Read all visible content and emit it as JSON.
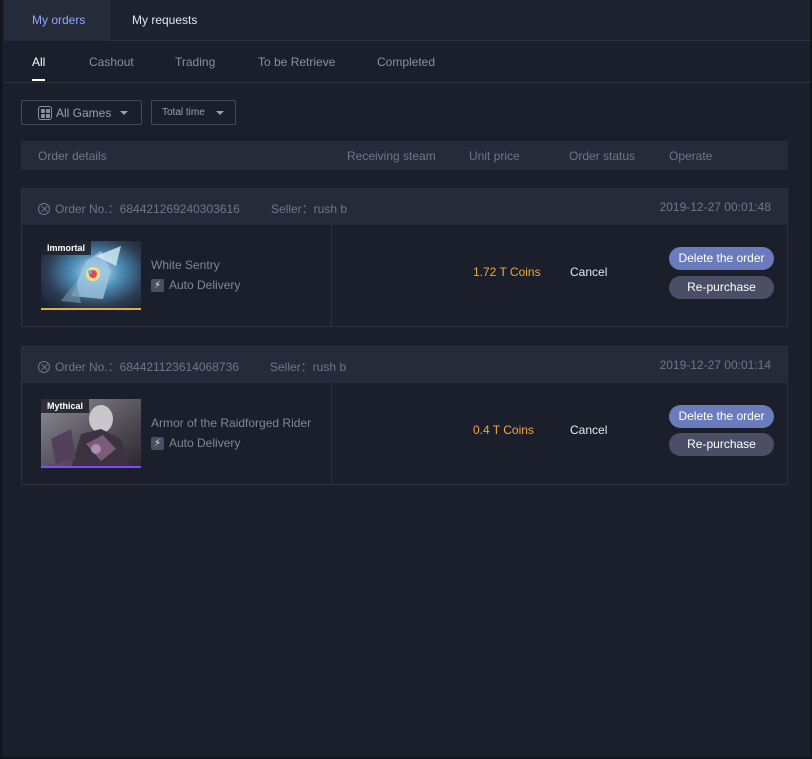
{
  "top_tabs": [
    {
      "label": "My orders",
      "active": true
    },
    {
      "label": "My requests",
      "active": false
    }
  ],
  "sub_tabs": [
    {
      "label": "All",
      "active": true
    },
    {
      "label": "Cashout",
      "active": false
    },
    {
      "label": "Trading",
      "active": false
    },
    {
      "label": "To be Retrieve",
      "active": false
    },
    {
      "label": "Completed",
      "active": false
    }
  ],
  "filters": {
    "games": {
      "label": "All Games",
      "icon": "grid-icon"
    },
    "time": {
      "label": "Total time"
    }
  },
  "table_header": {
    "order_details": "Order details",
    "receiving_steam": "Receiving steam",
    "unit_price": "Unit price",
    "order_status": "Order status",
    "operate": "Operate"
  },
  "orders": [
    {
      "order_no": "Order No.：684421269240303616",
      "seller": "Seller：rush b",
      "time": "2019-12-27 00:01:48",
      "rarity": "Immortal",
      "rarity_color": "#e4ae39",
      "item_name": "White Sentry",
      "delivery": "Auto Delivery",
      "price": "1.72 T Coins",
      "status": "Cancel",
      "delete_label": "Delete the order",
      "repurchase_label": "Re-purchase"
    },
    {
      "order_no": "Order No.：684421123614068736",
      "seller": "Seller：rush b",
      "time": "2019-12-27 00:01:14",
      "rarity": "Mythical",
      "rarity_color": "#8847ff",
      "item_name": "Armor of the Raidforged Rider",
      "delivery": "Auto Delivery",
      "price": "0.4 T Coins",
      "status": "Cancel",
      "delete_label": "Delete the order",
      "repurchase_label": "Re-purchase"
    }
  ],
  "colors": {
    "accent": "#8fa6ff",
    "price": "#f0a83a",
    "delete_button": "#6a7cbc",
    "repurchase_button": "#4a4f66"
  }
}
